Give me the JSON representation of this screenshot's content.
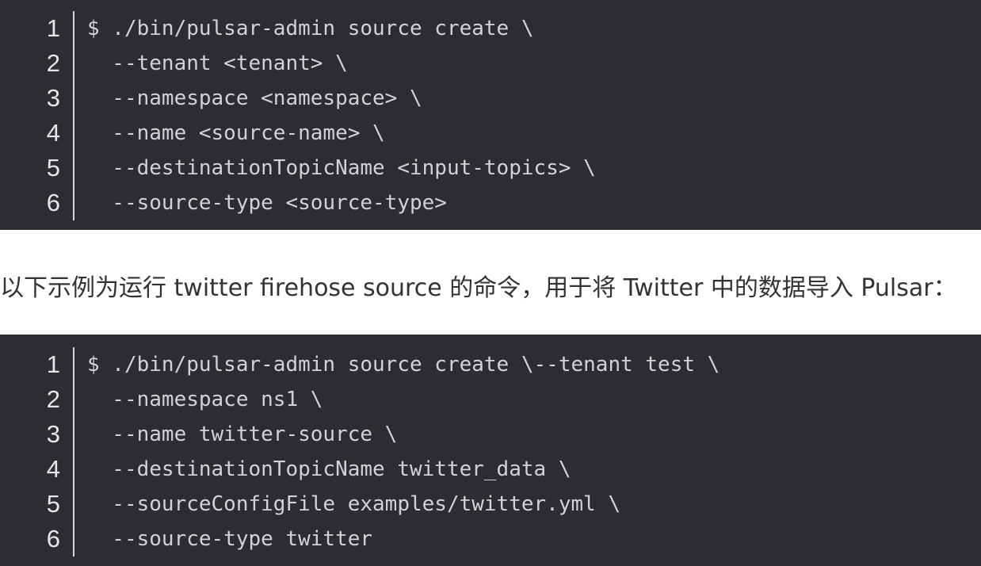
{
  "code_block_1": {
    "lines": [
      {
        "num": "1",
        "text": "$ ./bin/pulsar-admin source create \\"
      },
      {
        "num": "2",
        "text": "  --tenant <tenant> \\"
      },
      {
        "num": "3",
        "text": "  --namespace <namespace> \\"
      },
      {
        "num": "4",
        "text": "  --name <source-name> \\"
      },
      {
        "num": "5",
        "text": "  --destinationTopicName <input-topics> \\"
      },
      {
        "num": "6",
        "text": "  --source-type <source-type>"
      }
    ]
  },
  "prose": {
    "text": "以下示例为运行 twitter firehose source 的命令，用于将 Twitter 中的数据导入 Pulsar："
  },
  "code_block_2": {
    "lines": [
      {
        "num": "1",
        "text": "$ ./bin/pulsar-admin source create \\--tenant test \\"
      },
      {
        "num": "2",
        "text": "  --namespace ns1 \\"
      },
      {
        "num": "3",
        "text": "  --name twitter-source \\"
      },
      {
        "num": "4",
        "text": "  --destinationTopicName twitter_data \\"
      },
      {
        "num": "5",
        "text": "  --sourceConfigFile examples/twitter.yml \\"
      },
      {
        "num": "6",
        "text": "  --source-type twitter"
      }
    ]
  },
  "colors": {
    "code_background": "#2b2d33",
    "code_text": "#cfd2d6",
    "line_number": "#e6e6e6",
    "prose_text": "#333333"
  }
}
